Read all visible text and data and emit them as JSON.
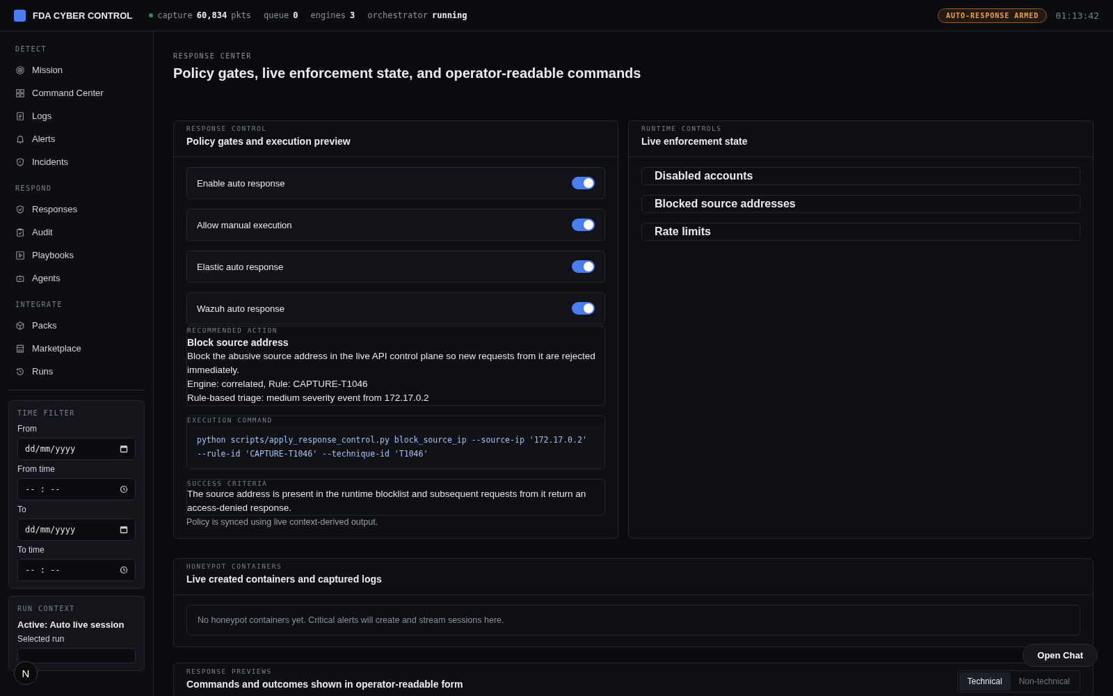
{
  "topbar": {
    "brand": "FDA CYBER CONTROL",
    "stats": [
      {
        "label": "capture",
        "value": "60,834",
        "unit": "pkts",
        "live": true
      },
      {
        "label": "queue",
        "value": "0"
      },
      {
        "label": "engines",
        "value": "3"
      },
      {
        "label": "orchestrator",
        "value": "running"
      }
    ],
    "badge": "AUTO-RESPONSE ARMED",
    "clock": "01:13:42"
  },
  "sidebar": {
    "sections": [
      {
        "title": "DETECT",
        "items": [
          {
            "label": "Mission"
          },
          {
            "label": "Command Center"
          },
          {
            "label": "Logs"
          },
          {
            "label": "Alerts"
          },
          {
            "label": "Incidents"
          }
        ]
      },
      {
        "title": "RESPOND",
        "items": [
          {
            "label": "Responses"
          },
          {
            "label": "Audit"
          },
          {
            "label": "Playbooks"
          },
          {
            "label": "Agents"
          }
        ]
      },
      {
        "title": "INTEGRATE",
        "items": [
          {
            "label": "Packs"
          },
          {
            "label": "Marketplace"
          },
          {
            "label": "Runs"
          }
        ]
      }
    ],
    "time_filter": {
      "title": "TIME FILTER",
      "fields": [
        {
          "label": "From",
          "placeholder": "dd/mm/yyyy",
          "kind": "date"
        },
        {
          "label": "From time",
          "placeholder": "-- : --",
          "kind": "time"
        },
        {
          "label": "To",
          "placeholder": "dd/mm/yyyy",
          "kind": "date"
        },
        {
          "label": "To time",
          "placeholder": "-- : --",
          "kind": "time"
        }
      ]
    },
    "run_context": {
      "title": "RUN CONTEXT",
      "active": "Active: Auto live session",
      "field_label": "Selected run"
    }
  },
  "page": {
    "eyebrow": "RESPONSE CENTER",
    "title": "Policy gates, live enforcement state, and operator-readable commands"
  },
  "response_control": {
    "eyebrow": "RESPONSE CONTROL",
    "title": "Policy gates and execution preview",
    "toggles": [
      {
        "label": "Enable auto response",
        "on": true
      },
      {
        "label": "Allow manual execution",
        "on": true
      },
      {
        "label": "Elastic auto response",
        "on": true
      },
      {
        "label": "Wazuh auto response",
        "on": true
      }
    ],
    "recommended": {
      "eyebrow": "RECOMMENDED ACTION",
      "title": "Block source address",
      "lines": [
        "Block the abusive source address in the live API control plane so new requests from it are rejected immediately.",
        "Engine: correlated, Rule: CAPTURE-T1046",
        "Rule-based triage: medium severity event from 172.17.0.2"
      ]
    },
    "command": {
      "eyebrow": "EXECUTION COMMAND",
      "code": "python scripts/apply_response_control.py block_source_ip --source-ip '172.17.0.2' --rule-id 'CAPTURE-T1046' --technique-id 'T1046'"
    },
    "success": {
      "eyebrow": "SUCCESS CRITERIA",
      "text": "The source address is present in the runtime blocklist and subsequent requests from it return an access-denied response."
    },
    "note": "Policy is synced using live context-derived output."
  },
  "runtime_controls": {
    "eyebrow": "RUNTIME CONTROLS",
    "title": "Live enforcement state",
    "groups": [
      "Disabled accounts",
      "Blocked source addresses",
      "Rate limits"
    ]
  },
  "honeypot": {
    "eyebrow": "HONEYPOT CONTAINERS",
    "title": "Live created containers and captured logs",
    "empty": "No honeypot containers yet. Critical alerts will create and stream sessions here."
  },
  "previews": {
    "eyebrow": "RESPONSE PREVIEWS",
    "title": "Commands and outcomes shown in operator-readable form",
    "modes": [
      {
        "label": "Technical",
        "selected": true
      },
      {
        "label": "Non-technical",
        "selected": false
      }
    ]
  },
  "dev_badge": "N",
  "chat_button": "Open Chat"
}
